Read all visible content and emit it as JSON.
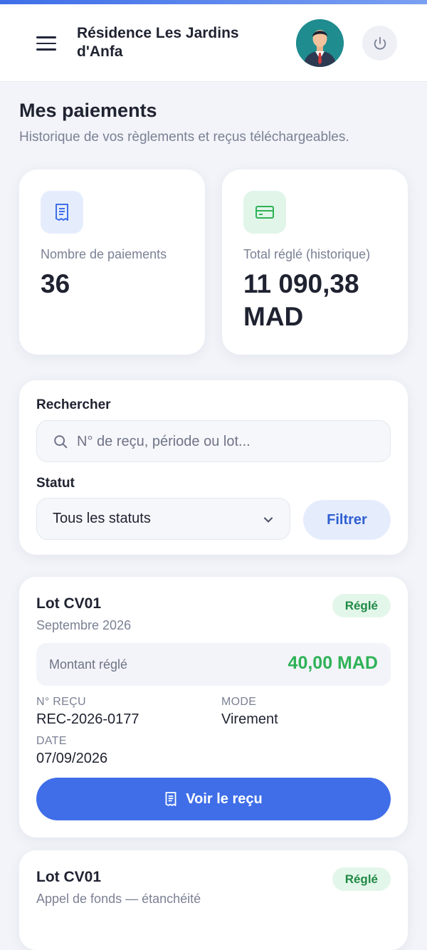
{
  "header": {
    "title": "Résidence Les Jardins d'Anfa",
    "menu_icon": "hamburger-menu-icon",
    "avatar_icon": "user-avatar",
    "power_icon": "power-icon"
  },
  "page": {
    "title": "Mes paiements",
    "subtitle": "Historique de vos règlements et reçus téléchargeables."
  },
  "stats": [
    {
      "label": "Nombre de paiements",
      "value": "36",
      "icon": "receipt-icon",
      "accent": "#3f6ee8"
    },
    {
      "label": "Total réglé (historique)",
      "value": "11 090,38 MAD",
      "icon": "credit-card-icon",
      "accent": "#2fb257"
    }
  ],
  "filters": {
    "search_label": "Rechercher",
    "search_placeholder": "N° de reçu, période ou lot...",
    "search_value": "",
    "status_label": "Statut",
    "status_selected": "Tous les statuts",
    "filter_button": "Filtrer"
  },
  "payments": [
    {
      "lot": "Lot CV01",
      "period": "Septembre 2026",
      "status": "Réglé",
      "amount_label": "Montant réglé",
      "amount": "40,00 MAD",
      "receipt_label": "N° REÇU",
      "receipt_no": "REC-2026-0177",
      "mode_label": "MODE",
      "mode": "Virement",
      "date_label": "DATE",
      "date": "07/09/2026",
      "button": "Voir le reçu"
    },
    {
      "lot": "Lot CV01",
      "period": "Appel de fonds — étanchéité",
      "status": "Réglé"
    }
  ],
  "colors": {
    "primary": "#3f6ee8",
    "success": "#2fb257",
    "badge_bg": "#e3f6ea",
    "page_bg": "#f2f4f9"
  }
}
